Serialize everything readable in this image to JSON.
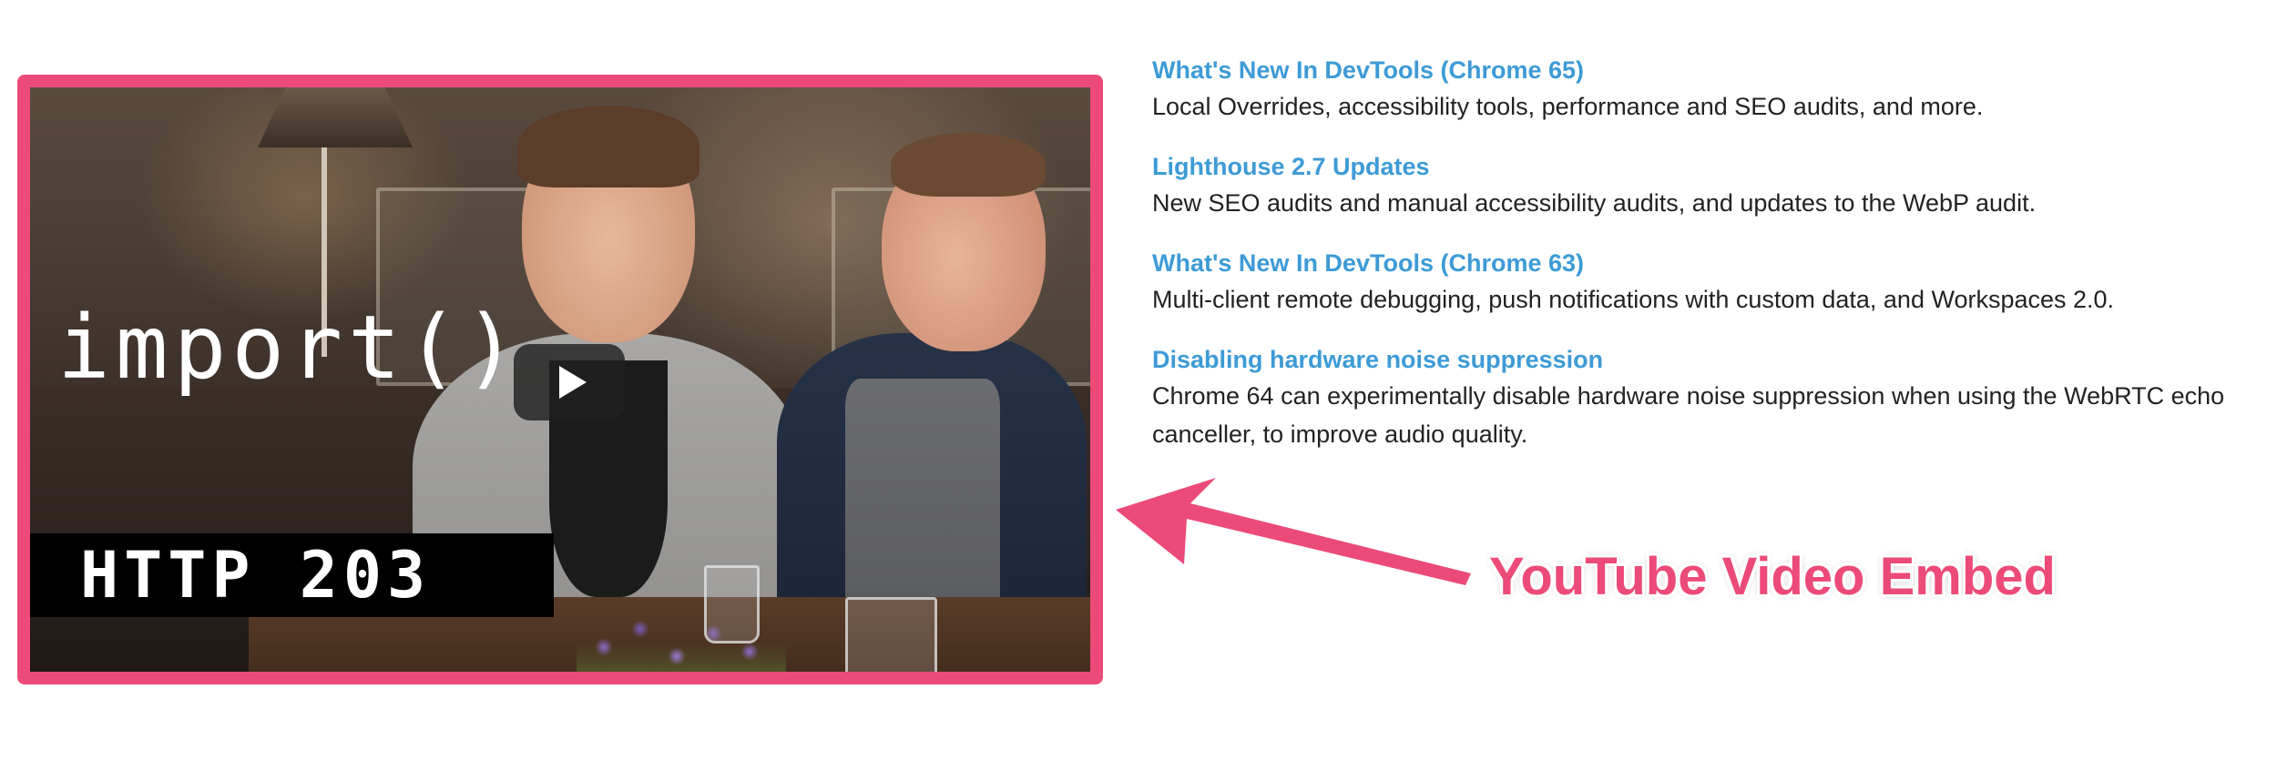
{
  "video": {
    "overlay_title": "import()",
    "overlay_badge": "HTTP 203",
    "border_color": "#ec4a78"
  },
  "articles": [
    {
      "title": "What's New In DevTools (Chrome 65)",
      "description": "Local Overrides, accessibility tools, performance and SEO audits, and more."
    },
    {
      "title": "Lighthouse 2.7 Updates",
      "description": "New SEO audits and manual accessibility audits, and updates to the WebP audit."
    },
    {
      "title": "What's New In DevTools (Chrome 63)",
      "description": "Multi-client remote debugging, push notifications with custom data, and Workspaces 2.0."
    },
    {
      "title": "Disabling hardware noise suppression",
      "description": "Chrome 64 can experimentally disable hardware noise suppression when using the WebRTC echo canceller, to improve audio quality."
    }
  ],
  "annotation": {
    "label": "YouTube Video Embed",
    "color": "#ec4a78"
  },
  "colors": {
    "link": "#3d9bd6",
    "text": "#222222"
  }
}
